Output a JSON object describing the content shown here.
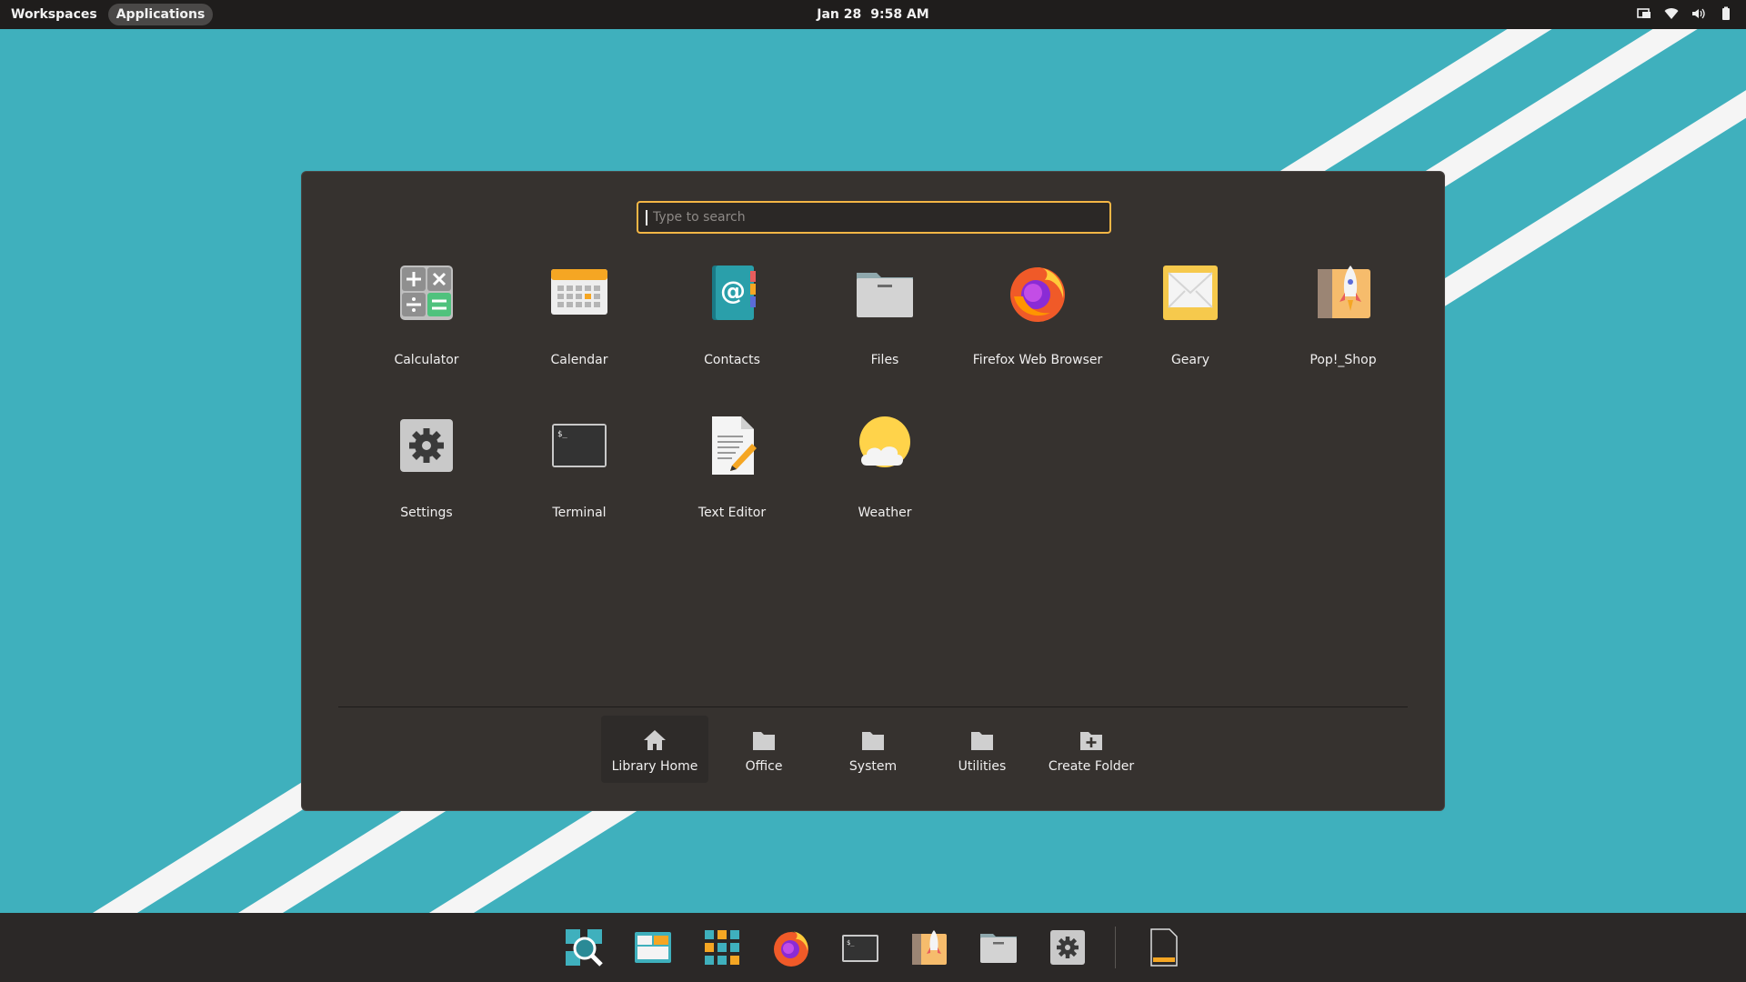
{
  "topbar": {
    "workspaces_label": "Workspaces",
    "applications_label": "Applications",
    "date": "Jan 28",
    "time": "9:58 AM",
    "tray_icons": [
      "display-icon",
      "wifi-icon",
      "volume-icon",
      "battery-icon"
    ]
  },
  "launcher": {
    "search_placeholder": "Type to search",
    "apps": [
      {
        "label": "Calculator",
        "icon": "calculator-icon"
      },
      {
        "label": "Calendar",
        "icon": "calendar-icon"
      },
      {
        "label": "Contacts",
        "icon": "contacts-icon"
      },
      {
        "label": "Files",
        "icon": "files-icon"
      },
      {
        "label": "Firefox Web Browser",
        "icon": "firefox-icon"
      },
      {
        "label": "Geary",
        "icon": "geary-icon"
      },
      {
        "label": "Pop!_Shop",
        "icon": "pop-shop-icon"
      },
      {
        "label": "Settings",
        "icon": "settings-icon"
      },
      {
        "label": "Terminal",
        "icon": "terminal-icon"
      },
      {
        "label": "Text Editor",
        "icon": "text-editor-icon"
      },
      {
        "label": "Weather",
        "icon": "weather-icon"
      }
    ],
    "folders": [
      {
        "label": "Library Home",
        "icon": "home-icon",
        "active": true
      },
      {
        "label": "Office",
        "icon": "folder-icon"
      },
      {
        "label": "System",
        "icon": "folder-icon"
      },
      {
        "label": "Utilities",
        "icon": "folder-icon"
      },
      {
        "label": "Create Folder",
        "icon": "folder-add-icon"
      }
    ]
  },
  "dock": {
    "items": [
      "search-icon",
      "workspaces-icon",
      "app-grid-icon",
      "firefox-icon",
      "terminal-icon",
      "pop-shop-icon",
      "files-icon",
      "settings-icon",
      "text-editor-icon"
    ]
  },
  "colors": {
    "accent": "#f4b645",
    "panel": "#36322f",
    "wallpaper": "#3fb0bd",
    "topbar": "#1f1d1c"
  }
}
